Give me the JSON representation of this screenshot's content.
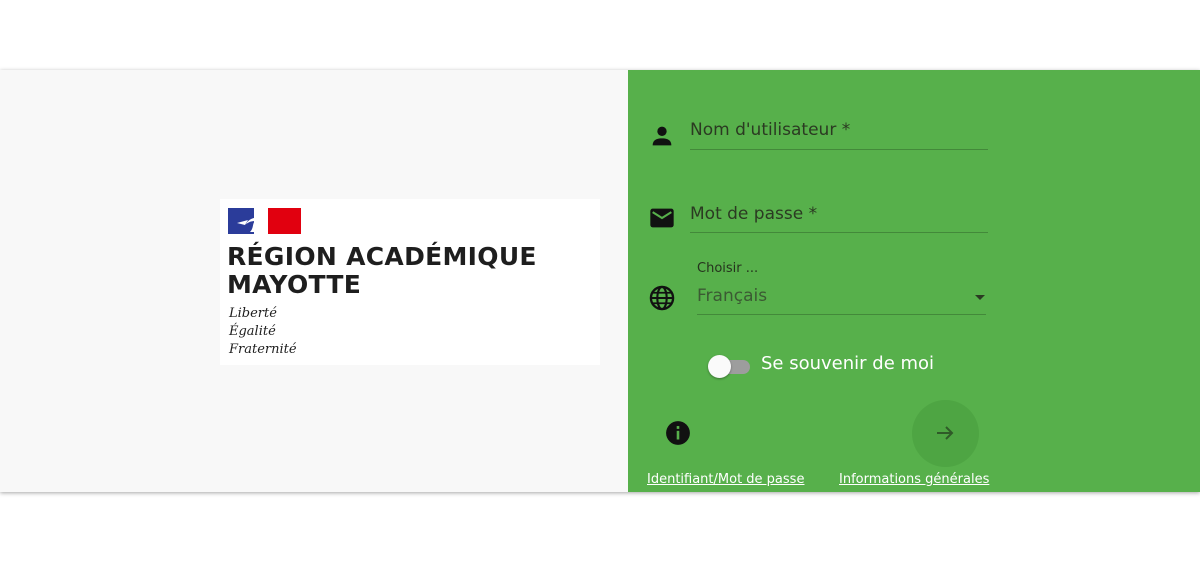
{
  "logo": {
    "title_line1": "RÉGION ACADÉMIQUE",
    "title_line2": "MAYOTTE",
    "motto": [
      "Liberté",
      "Égalité",
      "Fraternité"
    ]
  },
  "login": {
    "username_label": "Nom d'utilisateur *",
    "username_value": "",
    "password_label": "Mot de passe *",
    "password_value": "",
    "language_label": "Choisir ...",
    "language_value": "Français",
    "remember_label": "Se souvenir de moi",
    "remember_checked": false,
    "forgot_link": "Identifiant/Mot de passe",
    "info_link": "Informations générales"
  },
  "icons": {
    "username": "person-icon",
    "password": "mail-icon",
    "language": "globe-icon",
    "info": "info-icon",
    "submit": "arrow-right-icon",
    "select": "dropdown-arrow-icon"
  },
  "colors": {
    "panel_green": "#57b04b",
    "submit_button": "#4ea543",
    "left_background": "#f8f8f8",
    "flag_blue": "#2b3c9a",
    "flag_red": "#e1000f"
  }
}
